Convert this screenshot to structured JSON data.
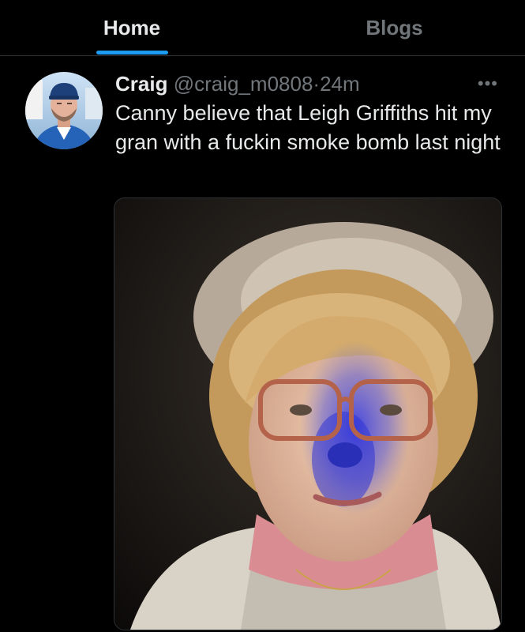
{
  "tabs": [
    {
      "label": "Home",
      "selected": true
    },
    {
      "label": "Blogs",
      "selected": false
    }
  ],
  "colors": {
    "accent": "#1d9bf0",
    "background": "#000000",
    "text_primary": "#e7e9ea",
    "text_secondary": "#71767b"
  },
  "tweet": {
    "author_name": "Craig",
    "handle": "@craig_m0808",
    "separator": "·",
    "time": "24m",
    "more_icon": "more-horizontal-icon",
    "text": "Canny believe that Leigh Griffiths hit my gran with a fuckin smoke bomb last night"
  }
}
